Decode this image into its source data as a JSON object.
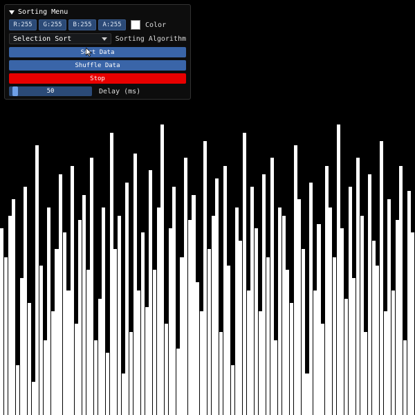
{
  "panel": {
    "title": "Sorting Menu",
    "color": {
      "r": "R:255",
      "g": "G:255",
      "b": "B:255",
      "a": "A:255",
      "label": "Color",
      "hex": "#ffffff"
    },
    "algorithm": {
      "selected": "Selection Sort",
      "label": "Sorting Algorithm"
    },
    "buttons": {
      "sort": "Sort Data",
      "shuffle": "Shuffle Data",
      "stop": "Stop"
    },
    "delay": {
      "value": "50",
      "label": "Delay (ms)",
      "handle_percent": 4
    }
  },
  "chart_data": {
    "type": "bar",
    "title": "",
    "xlabel": "",
    "ylabel": "",
    "ylim": [
      0,
      100
    ],
    "values": [
      45,
      38,
      48,
      52,
      12,
      33,
      55,
      27,
      8,
      65,
      36,
      18,
      50,
      25,
      40,
      58,
      44,
      30,
      60,
      22,
      47,
      53,
      35,
      62,
      18,
      28,
      50,
      15,
      68,
      40,
      48,
      10,
      56,
      20,
      63,
      30,
      44,
      26,
      59,
      35,
      50,
      70,
      22,
      45,
      55,
      16,
      38,
      62,
      47,
      53,
      32,
      25,
      66,
      40,
      48,
      57,
      20,
      60,
      36,
      12,
      50,
      42,
      68,
      30,
      55,
      45,
      25,
      58,
      38,
      62,
      18,
      50,
      48,
      35,
      27,
      65,
      52,
      40,
      10,
      56,
      30,
      46,
      22,
      60,
      50,
      38,
      70,
      45,
      28,
      55,
      33,
      62,
      48,
      20,
      58,
      42,
      36,
      66,
      25,
      52,
      30,
      47,
      60,
      18,
      54,
      44
    ]
  }
}
